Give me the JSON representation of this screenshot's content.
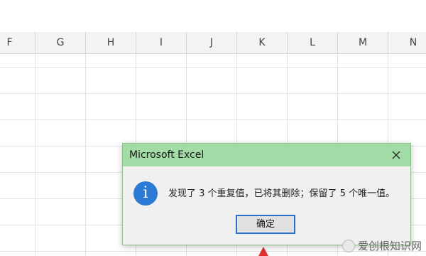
{
  "sheet": {
    "columns": [
      "F",
      "G",
      "H",
      "I",
      "J",
      "K",
      "L",
      "M",
      "N"
    ]
  },
  "dialog": {
    "title": "Microsoft Excel",
    "icon": "info-icon",
    "icon_glyph": "i",
    "message": "发现了 3 个重复值，已将其删除；保留了 5 个唯一值。",
    "ok_label": "确定",
    "close_glyph": "✕"
  },
  "watermark": {
    "text": "爱创根知识网"
  },
  "colors": {
    "title_bar": "#a3dba6",
    "info_icon": "#2a7ad6",
    "button_focus_border": "#2a6fc9",
    "arrow": "#e03030"
  }
}
